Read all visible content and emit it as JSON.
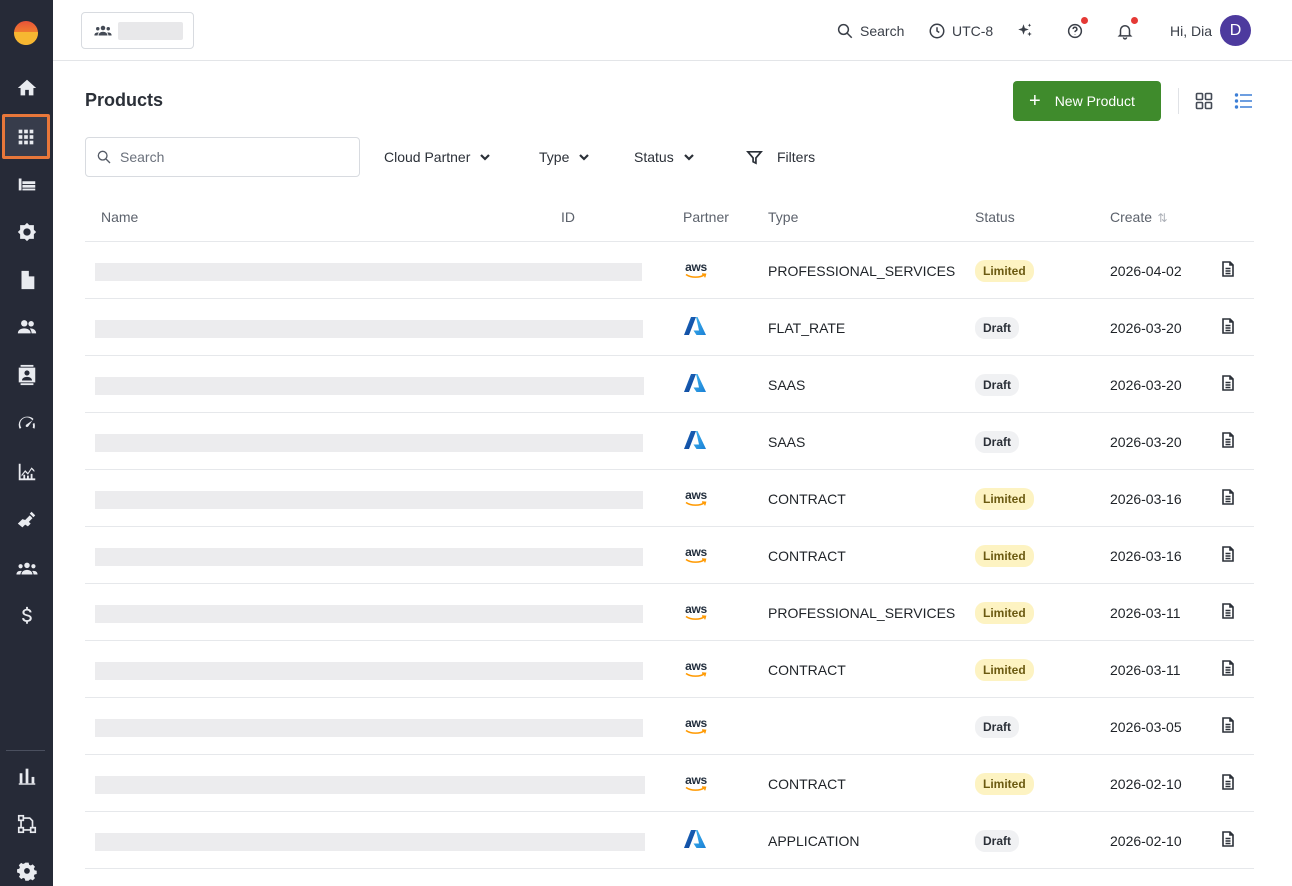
{
  "sidebar": {
    "items": [
      {
        "name": "home-icon"
      },
      {
        "name": "apps-grid-icon",
        "active": true
      },
      {
        "name": "listings-icon"
      },
      {
        "name": "settings-gear-icon"
      },
      {
        "name": "document-icon"
      },
      {
        "name": "people-icon"
      },
      {
        "name": "contacts-icon"
      },
      {
        "name": "speedometer-icon"
      },
      {
        "name": "analytics-icon"
      },
      {
        "name": "handshake-icon"
      },
      {
        "name": "team-icon"
      },
      {
        "name": "dollar-icon"
      },
      {
        "name": "bar-chart-icon"
      },
      {
        "name": "workflow-icon"
      },
      {
        "name": "gear-icon"
      }
    ]
  },
  "header": {
    "search_label": "Search",
    "timezone_label": "UTC-8",
    "greeting": "Hi, Dia",
    "avatar_initial": "D"
  },
  "page": {
    "title": "Products",
    "new_button_label": "New Product",
    "search_placeholder": "Search",
    "filters": {
      "cloud_partner": "Cloud Partner",
      "type": "Type",
      "status": "Status",
      "more": "Filters"
    }
  },
  "table": {
    "columns": {
      "name": "Name",
      "id": "ID",
      "partner": "Partner",
      "type": "Type",
      "status": "Status",
      "create": "Create"
    },
    "rows": [
      {
        "partner": "aws",
        "type": "PROFESSIONAL_SERVICES",
        "status": "Limited",
        "create": "2026-04-02"
      },
      {
        "partner": "azure",
        "type": "FLAT_RATE",
        "status": "Draft",
        "create": "2026-03-20"
      },
      {
        "partner": "azure",
        "type": "SAAS",
        "status": "Draft",
        "create": "2026-03-20"
      },
      {
        "partner": "azure",
        "type": "SAAS",
        "status": "Draft",
        "create": "2026-03-20"
      },
      {
        "partner": "aws",
        "type": "CONTRACT",
        "status": "Limited",
        "create": "2026-03-16"
      },
      {
        "partner": "aws",
        "type": "CONTRACT",
        "status": "Limited",
        "create": "2026-03-16"
      },
      {
        "partner": "aws",
        "type": "PROFESSIONAL_SERVICES",
        "status": "Limited",
        "create": "2026-03-11"
      },
      {
        "partner": "aws",
        "type": "CONTRACT",
        "status": "Limited",
        "create": "2026-03-11"
      },
      {
        "partner": "aws",
        "type": "",
        "status": "Draft",
        "create": "2026-03-05"
      },
      {
        "partner": "aws",
        "type": "CONTRACT",
        "status": "Limited",
        "create": "2026-02-10"
      },
      {
        "partner": "azure",
        "type": "APPLICATION",
        "status": "Draft",
        "create": "2026-02-10"
      }
    ]
  },
  "colors": {
    "sidebar_bg": "#262a37",
    "primary_green": "#3f8b2c",
    "active_outline": "#e8773a",
    "avatar_bg": "#4d3a9e",
    "limited_badge_bg": "#fdf3c2",
    "draft_badge_bg": "#f0f1f3",
    "list_view_active": "#3d7fd6"
  }
}
